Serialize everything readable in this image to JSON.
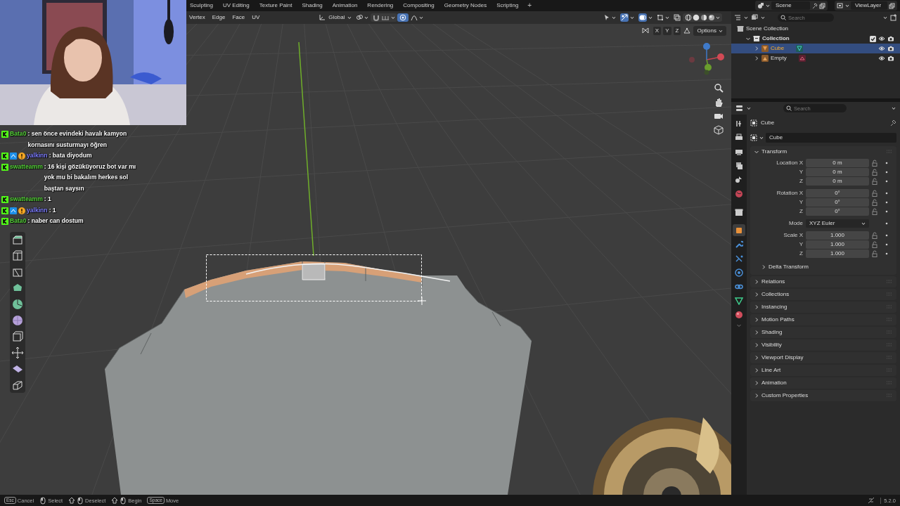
{
  "workspace_tabs": [
    {
      "label": "Sculpting"
    },
    {
      "label": "UV Editing"
    },
    {
      "label": "Texture Paint"
    },
    {
      "label": "Shading"
    },
    {
      "label": "Animation"
    },
    {
      "label": "Rendering"
    },
    {
      "label": "Compositing"
    },
    {
      "label": "Geometry Nodes"
    },
    {
      "label": "Scripting"
    }
  ],
  "add_tab": "+",
  "scene": "Scene",
  "view_layer": "ViewLayer",
  "viewport_header": {
    "select_modes": [
      "Vertex",
      "Edge",
      "Face",
      "UV"
    ],
    "orientation": "Global",
    "axes": [
      "X",
      "Y",
      "Z"
    ],
    "options": "Options"
  },
  "chat": [
    {
      "user": "Bata0",
      "color": "#56d23a",
      "verified": false,
      "message": ": sen önce evindeki havalı kamyon kornasını susturmayı öğren"
    },
    {
      "user": "yalkinn",
      "color": "#7d7dff",
      "verified": true,
      "message": ": bata diyodum"
    },
    {
      "user": "swatteamm",
      "color": "#56d23a",
      "verified": false,
      "message": ": 16 kişi gözüküyoruz bot var mı yok mu bi bakalım herkes sol baştan saysın"
    },
    {
      "user": "swatteamm",
      "color": "#56d23a",
      "verified": false,
      "message": ": 1"
    },
    {
      "user": "yalkinn",
      "color": "#7d7dff",
      "verified": true,
      "message": ": 1"
    },
    {
      "user": "Bata0",
      "color": "#56d23a",
      "verified": false,
      "message": ": naber can dostum"
    }
  ],
  "outliner": {
    "search_placeholder": "Search",
    "tree": [
      {
        "label": "Scene Collection",
        "kind": "scene_collection",
        "children": [
          {
            "label": "Collection",
            "kind": "collection",
            "expanded": true,
            "checked": true,
            "children": [
              {
                "label": "Cube",
                "kind": "mesh",
                "expanded": false,
                "selected": true
              },
              {
                "label": "Empty",
                "kind": "empty",
                "expanded": false,
                "selected": false
              }
            ]
          }
        ]
      }
    ]
  },
  "properties": {
    "search_placeholder": "Search",
    "context_title": "Cube",
    "object_name": "Cube",
    "tabs": [
      {
        "kind": "tool",
        "selected": false
      },
      {
        "kind": "render",
        "selected": false
      },
      {
        "kind": "output",
        "selected": false
      },
      {
        "kind": "view_layer",
        "selected": false
      },
      {
        "kind": "scene",
        "selected": false
      },
      {
        "kind": "world",
        "selected": false
      },
      {
        "kind": "collection",
        "selected": false
      },
      {
        "kind": "object",
        "selected": true
      },
      {
        "kind": "modifier",
        "selected": false
      },
      {
        "kind": "particles",
        "selected": false
      },
      {
        "kind": "physics",
        "selected": false
      },
      {
        "kind": "constraints",
        "selected": false
      },
      {
        "kind": "data",
        "selected": false
      },
      {
        "kind": "material",
        "selected": false
      }
    ],
    "transform": {
      "title": "Transform",
      "expanded": true,
      "groups": [
        {
          "rows": [
            {
              "label": "Location X",
              "value": "0 m",
              "kind": "number"
            },
            {
              "label": "Y",
              "value": "0 m",
              "kind": "number"
            },
            {
              "label": "Z",
              "value": "0 m",
              "kind": "number"
            }
          ]
        },
        {
          "rows": [
            {
              "label": "Rotation X",
              "value": "0°",
              "kind": "number"
            },
            {
              "label": "Y",
              "value": "0°",
              "kind": "number"
            },
            {
              "label": "Z",
              "value": "0°",
              "kind": "number"
            }
          ]
        },
        {
          "rows": [
            {
              "label": "Mode",
              "value": "XYZ Euler",
              "kind": "dropdown"
            }
          ]
        },
        {
          "rows": [
            {
              "label": "Scale X",
              "value": "1.000",
              "kind": "number"
            },
            {
              "label": "Y",
              "value": "1.000",
              "kind": "number"
            },
            {
              "label": "Z",
              "value": "1.000",
              "kind": "number"
            }
          ]
        }
      ],
      "subpanels": [
        {
          "title": "Delta Transform",
          "expanded": false
        }
      ]
    },
    "panels": [
      {
        "title": "Relations",
        "expanded": false
      },
      {
        "title": "Collections",
        "expanded": false
      },
      {
        "title": "Instancing",
        "expanded": false
      },
      {
        "title": "Motion Paths",
        "expanded": false
      },
      {
        "title": "Shading",
        "expanded": false
      },
      {
        "title": "Visibility",
        "expanded": false
      },
      {
        "title": "Viewport Display",
        "expanded": false
      },
      {
        "title": "Line Art",
        "expanded": false
      },
      {
        "title": "Animation",
        "expanded": false
      },
      {
        "title": "Custom Properties",
        "expanded": false
      }
    ]
  },
  "status_bar": {
    "items": [
      {
        "kind": "key",
        "key": "Esc",
        "label": "Cancel"
      },
      {
        "kind": "mouse",
        "label": "Select"
      },
      {
        "kind": "shift_mouse",
        "label": "Deselect"
      },
      {
        "kind": "shift_mouse",
        "label": "Begin"
      },
      {
        "kind": "key",
        "key": "Space",
        "label": "Move"
      }
    ],
    "version": "5.2.0"
  }
}
